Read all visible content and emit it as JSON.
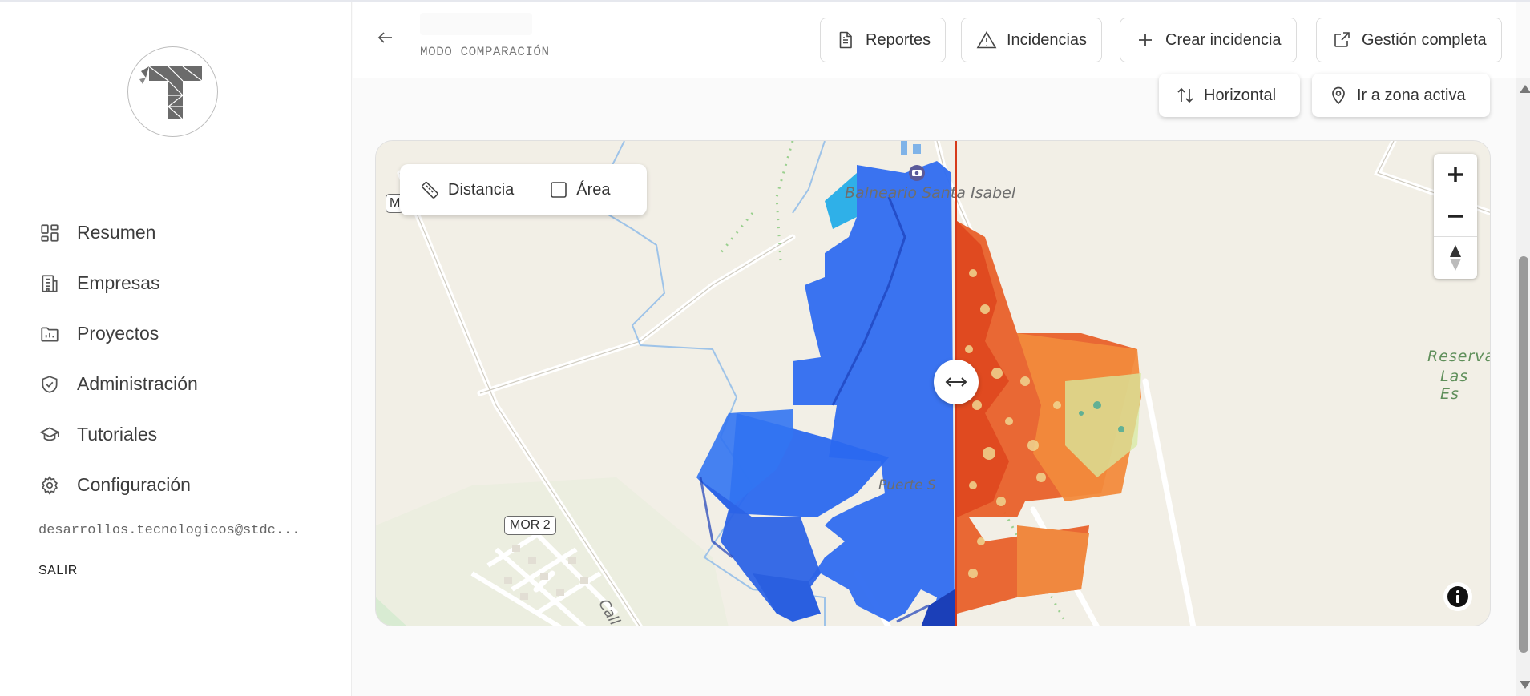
{
  "app": {
    "logo_icon": "triangulated-t-logo"
  },
  "sidebar": {
    "items": [
      {
        "label": "Resumen",
        "icon": "dashboard-icon"
      },
      {
        "label": "Empresas",
        "icon": "building-icon"
      },
      {
        "label": "Proyectos",
        "icon": "folder-chart-icon"
      },
      {
        "label": "Administración",
        "icon": "shield-check-icon"
      },
      {
        "label": "Tutoriales",
        "icon": "graduation-cap-icon"
      },
      {
        "label": "Configuración",
        "icon": "gear-icon"
      }
    ],
    "user_email": "desarrollos.tecnologicos@stdc...",
    "logout_label": "SALIR"
  },
  "header": {
    "mode_label": "MODO COMPARACIÓN",
    "buttons": [
      {
        "label": "Reportes",
        "icon": "file-text-icon"
      },
      {
        "label": "Incidencias",
        "icon": "warning-triangle-icon"
      },
      {
        "label": "Crear incidencia",
        "icon": "plus-icon"
      },
      {
        "label": "Gestión completa",
        "icon": "external-link-icon"
      }
    ]
  },
  "toolbar": {
    "orientation_label": "Horizontal",
    "goto_active_label": "Ir a zona activa"
  },
  "map": {
    "measure": {
      "distance_label": "Distancia",
      "area_label": "Área"
    },
    "labels": {
      "balneario": "Balneario Santa Isabel",
      "puerte": "Puerte S",
      "reserva_1": "Reserva",
      "reserva_2": "Las Es",
      "calle": "Call"
    },
    "shields": {
      "mor2": "MOR 2",
      "m": "M"
    },
    "colors": {
      "left_layer": "#2f6cf0",
      "right_layer": "#e8602a",
      "divider": "#d63a1a",
      "land": "#f2efe6"
    }
  }
}
